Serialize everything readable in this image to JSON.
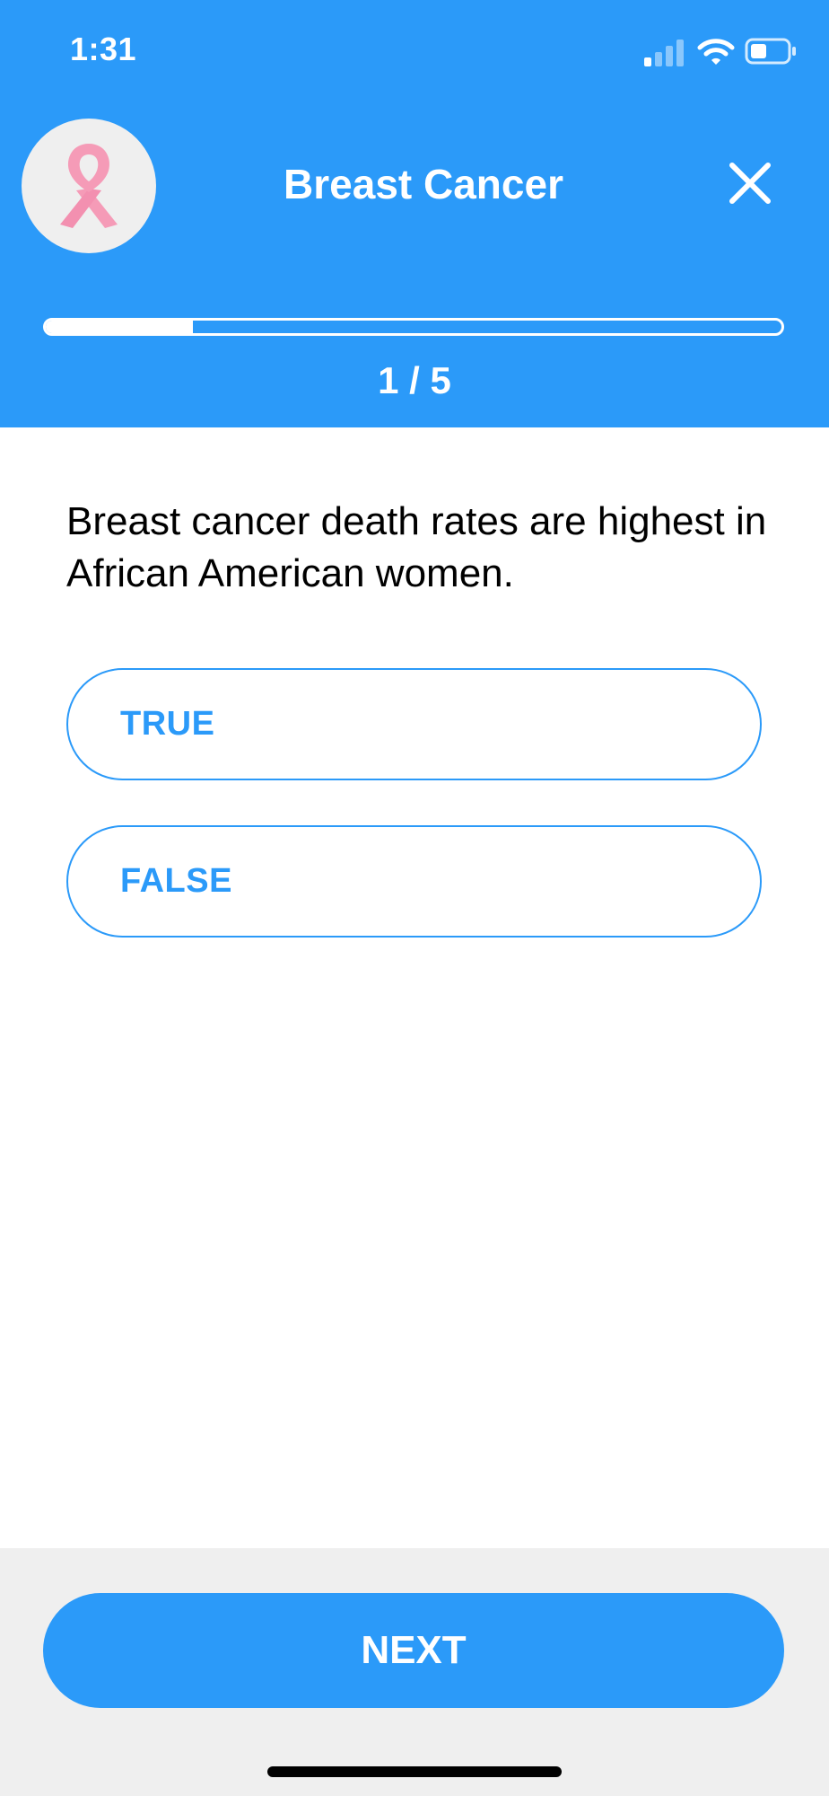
{
  "status_bar": {
    "time": "1:31"
  },
  "header": {
    "title": "Breast Cancer",
    "avatar_icon": "pink-ribbon-icon",
    "close_icon": "close-icon"
  },
  "progress": {
    "label": "1 / 5",
    "current": 1,
    "total": 5,
    "fraction": 0.2
  },
  "question": {
    "text": "Breast cancer death rates are highest in African American women."
  },
  "options": [
    {
      "label": "TRUE"
    },
    {
      "label": "FALSE"
    }
  ],
  "footer": {
    "next_label": "NEXT"
  },
  "colors": {
    "accent": "#2b9af9",
    "ribbon": "#f59bb7",
    "footer_bg": "#efefef"
  }
}
